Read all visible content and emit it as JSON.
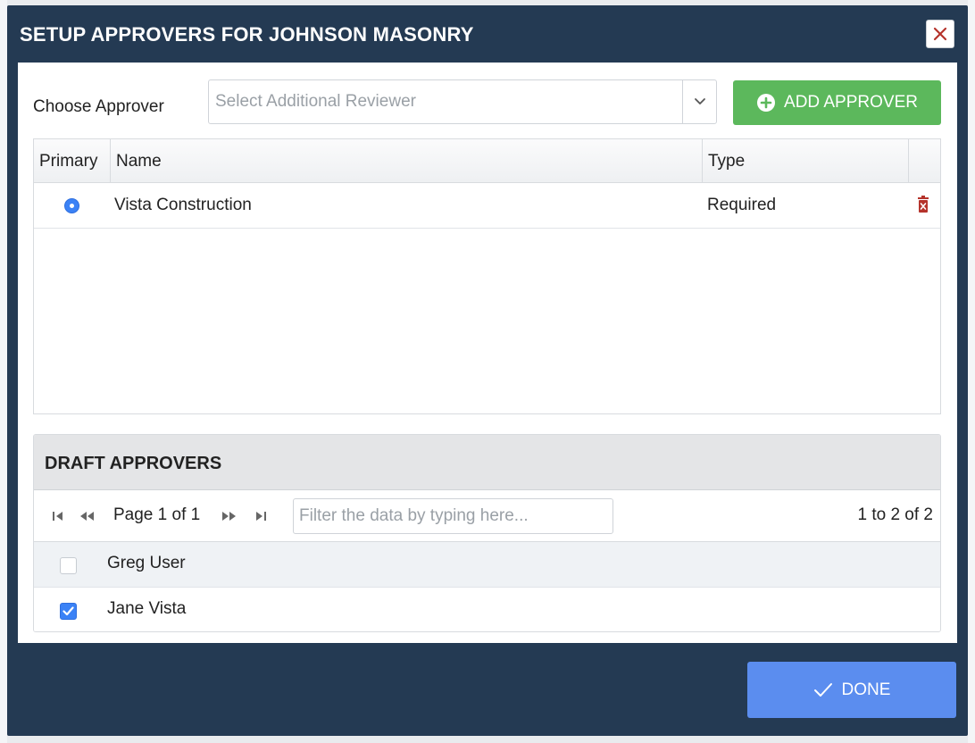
{
  "modal": {
    "title": "SETUP APPROVERS FOR JOHNSON MASONRY",
    "close_icon": "close-icon"
  },
  "approver_picker": {
    "label": "Choose Approver",
    "placeholder": "Select Additional Reviewer",
    "add_button_label": "ADD APPROVER",
    "add_icon": "plus-circle-icon"
  },
  "approver_table": {
    "columns": [
      "Primary",
      "Name",
      "Type"
    ],
    "rows": [
      {
        "primary": true,
        "name": "Vista Construction",
        "type": "Required",
        "delete_icon": "trash-icon"
      }
    ]
  },
  "draft_approvers": {
    "title": "DRAFT APPROVERS",
    "pager": {
      "page_text": "Page 1 of 1",
      "filter_placeholder": "Filter the data by typing here...",
      "range_text": "1 to 2 of 2"
    },
    "rows": [
      {
        "name": "Greg User",
        "checked": false
      },
      {
        "name": "Jane Vista",
        "checked": true
      }
    ]
  },
  "footer": {
    "done_label": "DONE",
    "done_icon": "checkmark-icon"
  },
  "colors": {
    "header_bg": "#243a53",
    "add_button": "#5cb85c",
    "done_button": "#5b8def",
    "accent_blue": "#3b82f6",
    "delete_red": "#b5332b"
  }
}
